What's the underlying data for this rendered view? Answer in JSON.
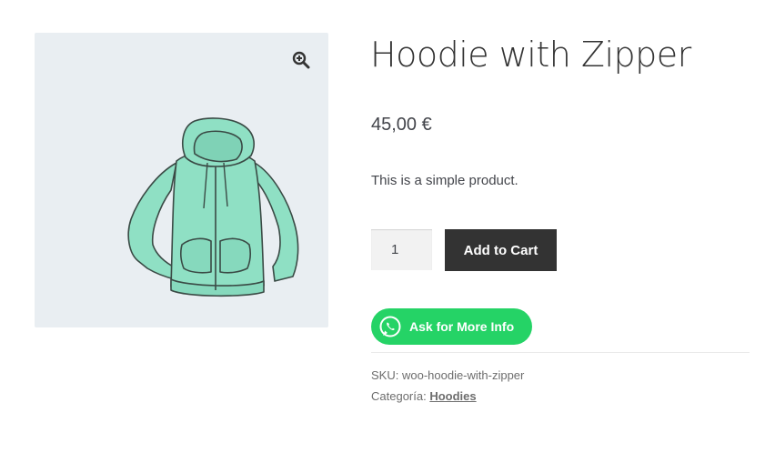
{
  "product": {
    "title": "Hoodie with Zipper",
    "price": "45,00 €",
    "short_description": "This is a simple product.",
    "image_icon": "hoodie-image",
    "zoom_icon": "magnify-plus-icon"
  },
  "cart_form": {
    "quantity_value": "1",
    "add_to_cart_label": "Add to Cart"
  },
  "whatsapp": {
    "label": "Ask for More Info",
    "icon": "whatsapp-icon",
    "color": "#25d366"
  },
  "meta": {
    "sku_label": "SKU:",
    "sku_value": "woo-hoodie-with-zipper",
    "category_label": "Categoría:",
    "category_value": "Hoodies"
  },
  "colors": {
    "button_dark": "#333333",
    "gallery_bg": "#e9eef2",
    "hoodie": "#8fe0c4"
  }
}
